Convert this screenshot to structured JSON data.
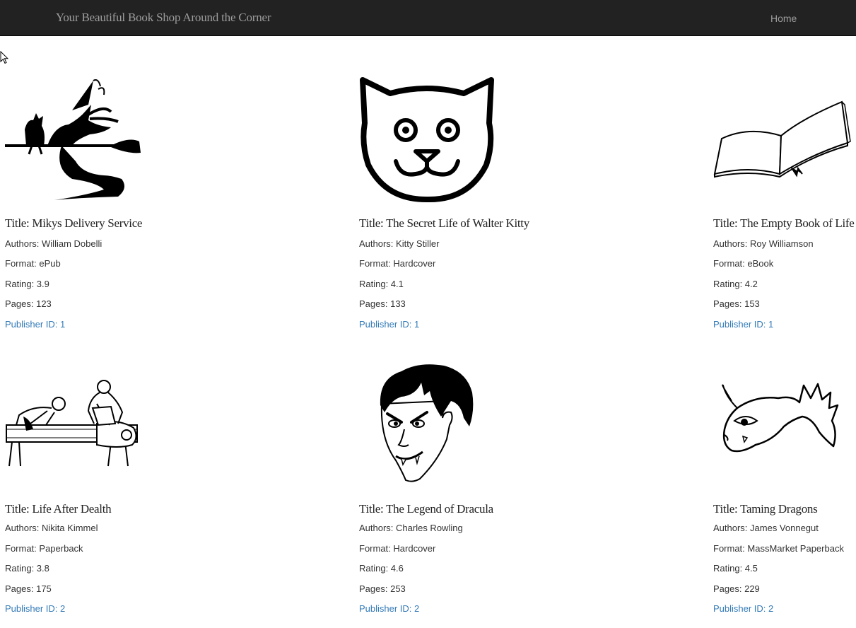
{
  "navbar": {
    "brand": "Your Beautiful Book Shop Around the Corner",
    "home_label": "Home"
  },
  "books": [
    {
      "title": "Title: Mikys Delivery Service",
      "authors": "Authors: William Dobelli",
      "format": "Format: ePub",
      "rating": "Rating: 3.9",
      "pages": "Pages: 123",
      "publisher": "Publisher ID: 1",
      "icon": "witch-on-broom-icon"
    },
    {
      "title": "Title: The Secret Life of Walter Kitty",
      "authors": "Authors: Kitty Stiller",
      "format": "Format: Hardcover",
      "rating": "Rating: 4.1",
      "pages": "Pages: 133",
      "publisher": "Publisher ID: 1",
      "icon": "cat-face-icon"
    },
    {
      "title": "Title: The Empty Book of Life",
      "authors": "Authors: Roy Williamson",
      "format": "Format: eBook",
      "rating": "Rating: 4.2",
      "pages": "Pages: 153",
      "publisher": "Publisher ID: 1",
      "icon": "open-book-icon"
    },
    {
      "title": "Title: Life After Dealth",
      "authors": "Authors: Nikita Kimmel",
      "format": "Format: Paperback",
      "rating": "Rating: 3.8",
      "pages": "Pages: 175",
      "publisher": "Publisher ID: 2",
      "icon": "mummification-icon"
    },
    {
      "title": "Title: The Legend of Dracula",
      "authors": "Authors: Charles Rowling",
      "format": "Format: Hardcover",
      "rating": "Rating: 4.6",
      "pages": "Pages: 253",
      "publisher": "Publisher ID: 2",
      "icon": "dracula-face-icon"
    },
    {
      "title": "Title: Taming Dragons",
      "authors": "Authors: James Vonnegut",
      "format": "Format: MassMarket Paperback",
      "rating": "Rating: 4.5",
      "pages": "Pages: 229",
      "publisher": "Publisher ID: 2",
      "icon": "dragon-head-icon"
    }
  ],
  "colors": {
    "navbar_bg": "#222222",
    "navbar_text": "#9d9d9d",
    "link": "#337ab7"
  }
}
